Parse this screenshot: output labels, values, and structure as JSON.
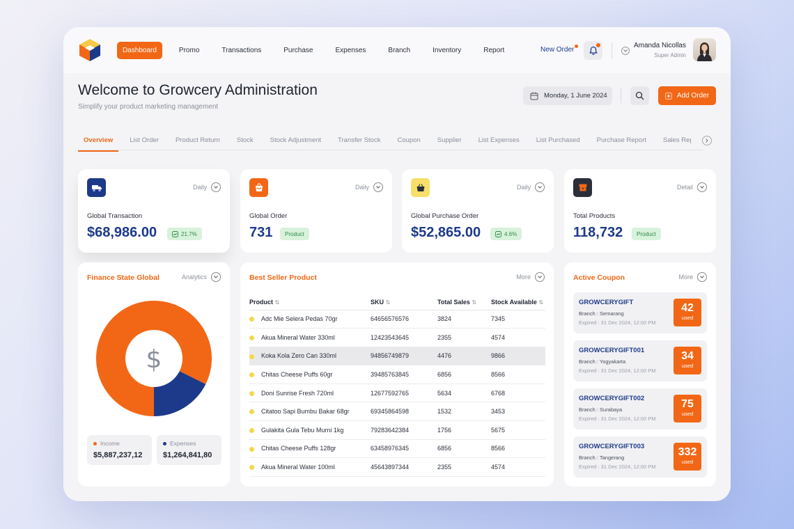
{
  "nav": {
    "items": [
      "Dashboard",
      "Promo",
      "Transactions",
      "Purchase",
      "Expenses",
      "Branch",
      "Inventory",
      "Report"
    ],
    "new_order": "New Order"
  },
  "user": {
    "name": "Amanda Nicollas",
    "role": "Super Admin"
  },
  "header": {
    "title": "Welcome to Growcery Administration",
    "subtitle": "Simplify your product marketing management",
    "date": "Monday, 1 June 2024",
    "add_order": "Add Order"
  },
  "tabs": [
    "Overview",
    "List Order",
    "Product Return",
    "Stock",
    "Stock Adjustment",
    "Transfer Stock",
    "Coupon",
    "Supplier",
    "List Expenses",
    "List Purchased",
    "Purchase Report",
    "Sales Rep"
  ],
  "stats": [
    {
      "label": "Global Transaction",
      "value": "$68,986.00",
      "period": "Daily",
      "badge": "21.7%",
      "icon": "truck-icon",
      "icon_bg": "#1d3a8a"
    },
    {
      "label": "Global Order",
      "value": "731",
      "period": "Daily",
      "badge": "Product",
      "icon": "bag-icon",
      "icon_bg": "#f26716"
    },
    {
      "label": "Global Purchase Order",
      "value": "$52,865.00",
      "period": "Daily",
      "badge": "4.6%",
      "icon": "basket-icon",
      "icon_bg": "#f7df6a"
    },
    {
      "label": "Total Products",
      "value": "118,732",
      "period": "Detail",
      "badge": "Product",
      "icon": "box-icon",
      "icon_bg": "#2a2f3a"
    }
  ],
  "finance": {
    "title": "Finance State Global",
    "link": "Analytics",
    "income_label": "Income",
    "income_value": "$5,887,237,12",
    "expenses_label": "Expenses",
    "expenses_value": "$1,264,841,80",
    "currency_symbol": "$",
    "colors": {
      "income": "#f26716",
      "expenses": "#1d3a8a"
    }
  },
  "chart_data": {
    "type": "pie",
    "categories": [
      "Income",
      "Expenses"
    ],
    "values": [
      5887237.12,
      1264841.8
    ]
  },
  "best_seller": {
    "title": "Best Seller Product",
    "more": "More",
    "columns": [
      "Product",
      "SKU",
      "Total Sales",
      "Stock Available"
    ],
    "sort_glyph": "⇅",
    "rows": [
      [
        "Adc Mie Selera Pedas 70gr",
        "64656576576",
        "3824",
        "7345"
      ],
      [
        "Akua Mineral Water 330ml",
        "12423543645",
        "2355",
        "4574"
      ],
      [
        "Koka Kola Zero Can 330ml",
        "94856749879",
        "4476",
        "9866"
      ],
      [
        "Chitas Cheese Puffs 60gr",
        "39485763845",
        "6856",
        "8566"
      ],
      [
        "Doni Sunrise Fresh 720ml",
        "12677592765",
        "5634",
        "6768"
      ],
      [
        "Citatoo Sapi Bumbu Bakar 68gr",
        "69345864598",
        "1532",
        "3453"
      ],
      [
        "Gulakita Gula Tebu Murni 1kg",
        "79283642384",
        "1756",
        "5675"
      ],
      [
        "Chitas Cheese Puffs 128gr",
        "63458976345",
        "6856",
        "8566"
      ],
      [
        "Akua Mineral Water 100ml",
        "45643897344",
        "2355",
        "4574"
      ]
    ]
  },
  "coupons": {
    "title": "Active Coupon",
    "more": "More",
    "used_label": "used",
    "items": [
      {
        "code": "GROWCERYGIFT",
        "branch": "Branch : Semarang",
        "expired": "Expired : 31 Dec 2024, 12:00 PM",
        "used": "42"
      },
      {
        "code": "GROWCERYGIFT001",
        "branch": "Branch : Yogyakarta",
        "expired": "Expired : 31 Dec 2024, 12:00 PM",
        "used": "34"
      },
      {
        "code": "GROWCERYGIFT002",
        "branch": "Branch : Surabaya",
        "expired": "Expired : 31 Dec 2024, 12:00 PM",
        "used": "75"
      },
      {
        "code": "GROWCERYGIFT003",
        "branch": "Branch : Tangerang",
        "expired": "Expired : 31 Dec 2024, 12:00 PM",
        "used": "332"
      }
    ]
  }
}
